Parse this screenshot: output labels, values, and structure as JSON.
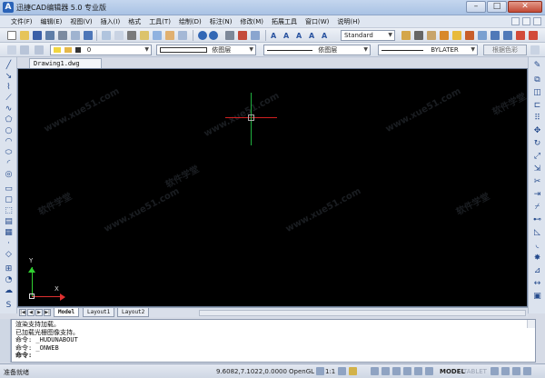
{
  "window": {
    "title": "迅捷CAD编辑器 5.0 专业版",
    "buttons": [
      "–",
      "□",
      "✕"
    ]
  },
  "menu": [
    "文件(F)",
    "编辑(E)",
    "视图(V)",
    "插入(I)",
    "格式",
    "工具(T)",
    "绘制(D)",
    "标注(N)",
    "修改(M)",
    "拓展工具",
    "窗口(W)",
    "说明(H)"
  ],
  "toolbar": {
    "text_style": "Standard",
    "layer": "0",
    "color_dropdown": "依图层",
    "linetype_dropdown": "依图层",
    "lineweight_dropdown": "BYLATER",
    "plot_color_button": "根据色彩"
  },
  "document": {
    "tab": "Drawing1.dwg"
  },
  "canvas": {
    "watermark": "www.xue51.com",
    "watermark_cn": "软件学堂",
    "ucs_y": "Y",
    "ucs_x": "X"
  },
  "layout_tabs": [
    {
      "label": "Model",
      "active": true
    },
    {
      "label": "Layout1",
      "active": false
    },
    {
      "label": "Layout2",
      "active": false
    }
  ],
  "command": {
    "lines": [
      "渲染支持加载。",
      "已加载光栅图像支持。",
      "命令:  _HUDUNABOUT",
      "命令:  _ONWEB",
      "命令:"
    ]
  },
  "status": {
    "ready": "准备就绪",
    "coords": "9.6082,7.1022,0.0000",
    "opengl": "OpenGL",
    "scale": "1:1",
    "model": "MODEL",
    "tablet": "TABLET"
  },
  "colors": {
    "crosshair_h": "#d02020",
    "crosshair_v": "#20b040",
    "ucs_y": "#30d030",
    "ucs_x": "#e03030"
  }
}
